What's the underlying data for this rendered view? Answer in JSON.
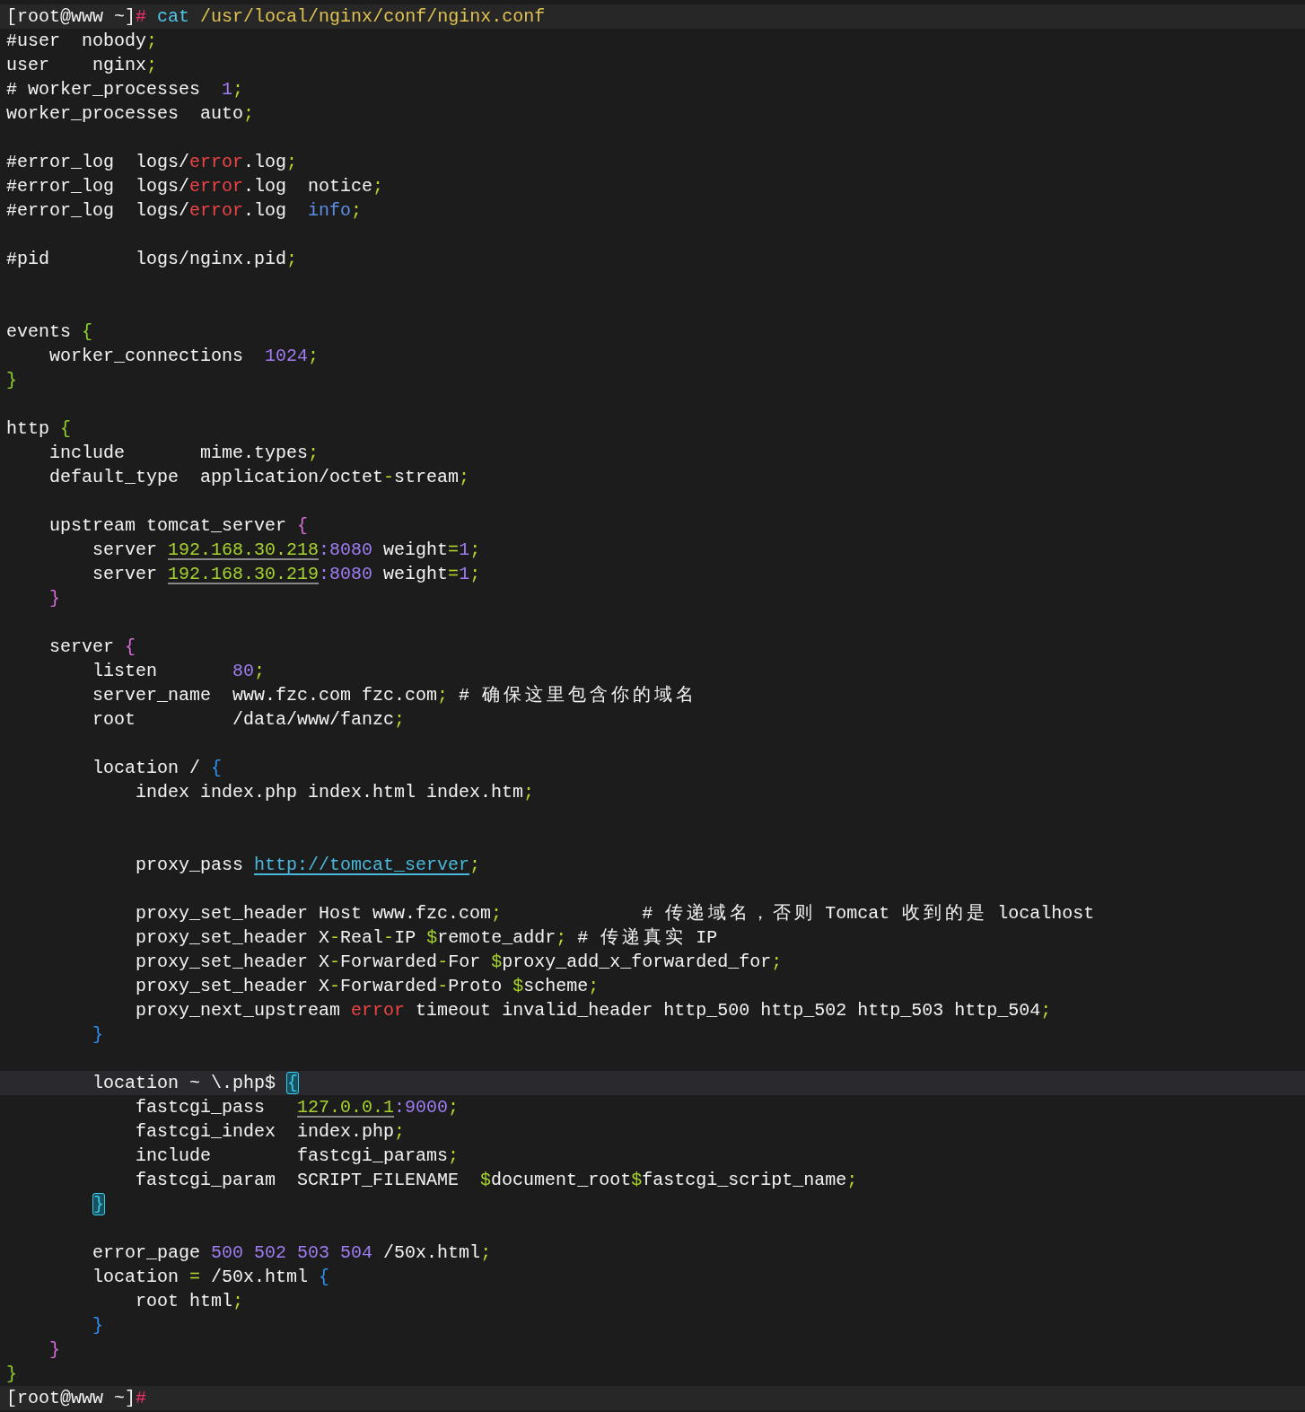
{
  "lines": [
    {
      "kind": "prompt",
      "segments": [
        {
          "t": "[root@www ~]",
          "kind": "plain"
        },
        {
          "t": "#",
          "kind": "prompt-mark"
        },
        {
          "t": " cat",
          "kind": "command"
        },
        {
          "t": " /usr/local/nginx/conf/nginx.conf",
          "kind": "path"
        }
      ]
    },
    {
      "kind": "code",
      "highlighted": false,
      "segments": [
        {
          "t": "#user  nobody",
          "kind": "plain"
        },
        {
          "t": ";",
          "kind": "punct"
        }
      ]
    },
    {
      "kind": "code",
      "highlighted": false,
      "segments": [
        {
          "t": "user    nginx",
          "kind": "plain"
        },
        {
          "t": ";",
          "kind": "punct"
        }
      ]
    },
    {
      "kind": "code",
      "highlighted": false,
      "segments": [
        {
          "t": "# worker_processes  ",
          "kind": "plain"
        },
        {
          "t": "1",
          "kind": "number"
        },
        {
          "t": ";",
          "kind": "punct"
        }
      ]
    },
    {
      "kind": "code",
      "highlighted": false,
      "segments": [
        {
          "t": "worker_processes  auto",
          "kind": "plain"
        },
        {
          "t": ";",
          "kind": "punct"
        }
      ]
    },
    {
      "kind": "blank"
    },
    {
      "kind": "code",
      "highlighted": false,
      "segments": [
        {
          "t": "#error_log  logs/",
          "kind": "plain"
        },
        {
          "t": "error",
          "kind": "keyword"
        },
        {
          "t": ".log",
          "kind": "plain"
        },
        {
          "t": ";",
          "kind": "punct"
        }
      ]
    },
    {
      "kind": "code",
      "highlighted": false,
      "segments": [
        {
          "t": "#error_log  logs/",
          "kind": "plain"
        },
        {
          "t": "error",
          "kind": "keyword"
        },
        {
          "t": ".log  notice",
          "kind": "plain"
        },
        {
          "t": ";",
          "kind": "punct"
        }
      ]
    },
    {
      "kind": "code",
      "highlighted": false,
      "segments": [
        {
          "t": "#error_log  logs/",
          "kind": "plain"
        },
        {
          "t": "error",
          "kind": "keyword"
        },
        {
          "t": ".log  ",
          "kind": "plain"
        },
        {
          "t": "info",
          "kind": "info"
        },
        {
          "t": ";",
          "kind": "punct"
        }
      ]
    },
    {
      "kind": "blank"
    },
    {
      "kind": "code",
      "highlighted": false,
      "segments": [
        {
          "t": "#pid        logs/nginx.pid",
          "kind": "plain"
        },
        {
          "t": ";",
          "kind": "punct"
        }
      ]
    },
    {
      "kind": "blank"
    },
    {
      "kind": "blank"
    },
    {
      "kind": "code",
      "highlighted": false,
      "segments": [
        {
          "t": "events ",
          "kind": "plain"
        },
        {
          "t": "{",
          "kind": "brace-green"
        }
      ]
    },
    {
      "kind": "code",
      "highlighted": false,
      "segments": [
        {
          "t": "    worker_connections  ",
          "kind": "plain"
        },
        {
          "t": "1024",
          "kind": "number"
        },
        {
          "t": ";",
          "kind": "punct"
        }
      ]
    },
    {
      "kind": "code",
      "highlighted": false,
      "segments": [
        {
          "t": "}",
          "kind": "brace-green"
        }
      ]
    },
    {
      "kind": "blank"
    },
    {
      "kind": "code",
      "highlighted": false,
      "segments": [
        {
          "t": "http ",
          "kind": "plain"
        },
        {
          "t": "{",
          "kind": "brace-green"
        }
      ]
    },
    {
      "kind": "code",
      "highlighted": false,
      "segments": [
        {
          "t": "    include       mime.types",
          "kind": "plain"
        },
        {
          "t": ";",
          "kind": "punct"
        }
      ]
    },
    {
      "kind": "code",
      "highlighted": false,
      "segments": [
        {
          "t": "    default_type  application/octet",
          "kind": "plain"
        },
        {
          "t": "-",
          "kind": "punct"
        },
        {
          "t": "stream",
          "kind": "plain"
        },
        {
          "t": ";",
          "kind": "punct"
        }
      ]
    },
    {
      "kind": "blank"
    },
    {
      "kind": "code",
      "highlighted": false,
      "segments": [
        {
          "t": "    upstream tomcat_server ",
          "kind": "plain"
        },
        {
          "t": "{",
          "kind": "brace-magenta"
        }
      ]
    },
    {
      "kind": "code",
      "highlighted": false,
      "segments": [
        {
          "t": "        server ",
          "kind": "plain"
        },
        {
          "t": "192.168.30.218",
          "kind": "ip"
        },
        {
          "t": ":8080",
          "kind": "number"
        },
        {
          "t": " weight",
          "kind": "plain"
        },
        {
          "t": "=",
          "kind": "punct"
        },
        {
          "t": "1",
          "kind": "number"
        },
        {
          "t": ";",
          "kind": "punct"
        }
      ]
    },
    {
      "kind": "code",
      "highlighted": false,
      "segments": [
        {
          "t": "        server ",
          "kind": "plain"
        },
        {
          "t": "192.168.30.219",
          "kind": "ip"
        },
        {
          "t": ":8080",
          "kind": "number"
        },
        {
          "t": " weight",
          "kind": "plain"
        },
        {
          "t": "=",
          "kind": "punct"
        },
        {
          "t": "1",
          "kind": "number"
        },
        {
          "t": ";",
          "kind": "punct"
        }
      ]
    },
    {
      "kind": "code",
      "highlighted": false,
      "segments": [
        {
          "t": "    }",
          "kind": "brace-magenta"
        }
      ]
    },
    {
      "kind": "blank"
    },
    {
      "kind": "code",
      "highlighted": false,
      "segments": [
        {
          "t": "    server ",
          "kind": "plain"
        },
        {
          "t": "{",
          "kind": "brace-magenta"
        }
      ]
    },
    {
      "kind": "code",
      "highlighted": false,
      "segments": [
        {
          "t": "        listen       ",
          "kind": "plain"
        },
        {
          "t": "80",
          "kind": "number"
        },
        {
          "t": ";",
          "kind": "punct"
        }
      ]
    },
    {
      "kind": "code",
      "highlighted": false,
      "segments": [
        {
          "t": "        server_name  www.fzc.com fzc.com",
          "kind": "plain"
        },
        {
          "t": ";",
          "kind": "punct"
        },
        {
          "t": " # 确保这里包含你的域名",
          "kind": "plain"
        }
      ]
    },
    {
      "kind": "code",
      "highlighted": false,
      "segments": [
        {
          "t": "        root         /data/www/fanzc",
          "kind": "plain"
        },
        {
          "t": ";",
          "kind": "punct"
        }
      ]
    },
    {
      "kind": "blank"
    },
    {
      "kind": "code",
      "highlighted": false,
      "segments": [
        {
          "t": "        location / ",
          "kind": "plain"
        },
        {
          "t": "{",
          "kind": "brace-blue"
        }
      ]
    },
    {
      "kind": "code",
      "highlighted": false,
      "segments": [
        {
          "t": "            index index.php index.html index.htm",
          "kind": "plain"
        },
        {
          "t": ";",
          "kind": "punct"
        }
      ]
    },
    {
      "kind": "blank"
    },
    {
      "kind": "blank"
    },
    {
      "kind": "code",
      "highlighted": false,
      "segments": [
        {
          "t": "            proxy_pass ",
          "kind": "plain"
        },
        {
          "t": "http://tomcat_server",
          "kind": "url"
        },
        {
          "t": ";",
          "kind": "punct"
        }
      ]
    },
    {
      "kind": "blank"
    },
    {
      "kind": "code",
      "highlighted": false,
      "segments": [
        {
          "t": "            proxy_set_header Host www.fzc.com",
          "kind": "plain"
        },
        {
          "t": ";",
          "kind": "punct"
        },
        {
          "t": "             # 传递域名，否则 Tomcat 收到的是 localhost",
          "kind": "plain"
        }
      ]
    },
    {
      "kind": "code",
      "highlighted": false,
      "segments": [
        {
          "t": "            proxy_set_header X",
          "kind": "plain"
        },
        {
          "t": "-",
          "kind": "punct"
        },
        {
          "t": "Real",
          "kind": "plain"
        },
        {
          "t": "-",
          "kind": "punct"
        },
        {
          "t": "IP ",
          "kind": "plain"
        },
        {
          "t": "$",
          "kind": "var"
        },
        {
          "t": "remote_addr",
          "kind": "plain"
        },
        {
          "t": ";",
          "kind": "punct"
        },
        {
          "t": " # 传递真实 IP",
          "kind": "plain"
        }
      ]
    },
    {
      "kind": "code",
      "highlighted": false,
      "segments": [
        {
          "t": "            proxy_set_header X",
          "kind": "plain"
        },
        {
          "t": "-",
          "kind": "punct"
        },
        {
          "t": "Forwarded",
          "kind": "plain"
        },
        {
          "t": "-",
          "kind": "punct"
        },
        {
          "t": "For ",
          "kind": "plain"
        },
        {
          "t": "$",
          "kind": "var"
        },
        {
          "t": "proxy_add_x_forwarded_for",
          "kind": "plain"
        },
        {
          "t": ";",
          "kind": "punct"
        }
      ]
    },
    {
      "kind": "code",
      "highlighted": false,
      "segments": [
        {
          "t": "            proxy_set_header X",
          "kind": "plain"
        },
        {
          "t": "-",
          "kind": "punct"
        },
        {
          "t": "Forwarded",
          "kind": "plain"
        },
        {
          "t": "-",
          "kind": "punct"
        },
        {
          "t": "Proto ",
          "kind": "plain"
        },
        {
          "t": "$",
          "kind": "var"
        },
        {
          "t": "scheme",
          "kind": "plain"
        },
        {
          "t": ";",
          "kind": "punct"
        }
      ]
    },
    {
      "kind": "code",
      "highlighted": false,
      "segments": [
        {
          "t": "            proxy_next_upstream ",
          "kind": "plain"
        },
        {
          "t": "error",
          "kind": "keyword"
        },
        {
          "t": " timeout invalid_header http_500 http_502 http_503 http_504",
          "kind": "plain"
        },
        {
          "t": ";",
          "kind": "punct"
        }
      ]
    },
    {
      "kind": "code",
      "highlighted": false,
      "segments": [
        {
          "t": "        }",
          "kind": "brace-blue"
        }
      ]
    },
    {
      "kind": "blank"
    },
    {
      "kind": "code",
      "highlighted": true,
      "segments": [
        {
          "t": "        location ~ \\.php$ ",
          "kind": "plain"
        },
        {
          "t": "{",
          "kind": "bracket-match"
        }
      ]
    },
    {
      "kind": "code",
      "highlighted": false,
      "segments": [
        {
          "t": "            fastcgi_pass   ",
          "kind": "plain"
        },
        {
          "t": "127.0.0.1",
          "kind": "ip"
        },
        {
          "t": ":9000",
          "kind": "number"
        },
        {
          "t": ";",
          "kind": "punct"
        }
      ]
    },
    {
      "kind": "code",
      "highlighted": false,
      "segments": [
        {
          "t": "            fastcgi_index  index.php",
          "kind": "plain"
        },
        {
          "t": ";",
          "kind": "punct"
        }
      ]
    },
    {
      "kind": "code",
      "highlighted": false,
      "segments": [
        {
          "t": "            include        fastcgi_params",
          "kind": "plain"
        },
        {
          "t": ";",
          "kind": "punct"
        }
      ]
    },
    {
      "kind": "code",
      "highlighted": false,
      "segments": [
        {
          "t": "            fastcgi_param  SCRIPT_FILENAME  ",
          "kind": "plain"
        },
        {
          "t": "$",
          "kind": "var"
        },
        {
          "t": "document_root",
          "kind": "plain"
        },
        {
          "t": "$",
          "kind": "var"
        },
        {
          "t": "fastcgi_script_name",
          "kind": "plain"
        },
        {
          "t": ";",
          "kind": "punct"
        }
      ]
    },
    {
      "kind": "code",
      "highlighted": false,
      "segments": [
        {
          "t": "        }",
          "kind": "bracket-match"
        }
      ]
    },
    {
      "kind": "blank"
    },
    {
      "kind": "code",
      "highlighted": false,
      "segments": [
        {
          "t": "        error_page ",
          "kind": "plain"
        },
        {
          "t": "500 502 503 504",
          "kind": "number"
        },
        {
          "t": " /50x.html",
          "kind": "plain"
        },
        {
          "t": ";",
          "kind": "punct"
        }
      ]
    },
    {
      "kind": "code",
      "highlighted": false,
      "segments": [
        {
          "t": "        location ",
          "kind": "plain"
        },
        {
          "t": "=",
          "kind": "punct"
        },
        {
          "t": " /50x.html ",
          "kind": "plain"
        },
        {
          "t": "{",
          "kind": "brace-blue"
        }
      ]
    },
    {
      "kind": "code",
      "highlighted": false,
      "segments": [
        {
          "t": "            root html",
          "kind": "plain"
        },
        {
          "t": ";",
          "kind": "punct"
        }
      ]
    },
    {
      "kind": "code",
      "highlighted": false,
      "segments": [
        {
          "t": "        }",
          "kind": "brace-blue"
        }
      ]
    },
    {
      "kind": "code",
      "highlighted": false,
      "segments": [
        {
          "t": "    }",
          "kind": "brace-magenta"
        }
      ]
    },
    {
      "kind": "code",
      "highlighted": false,
      "segments": [
        {
          "t": "}",
          "kind": "brace-green"
        }
      ]
    },
    {
      "kind": "prompt",
      "segments": [
        {
          "t": "[root@www ~]",
          "kind": "plain"
        },
        {
          "t": "#",
          "kind": "prompt-mark"
        }
      ]
    }
  ]
}
